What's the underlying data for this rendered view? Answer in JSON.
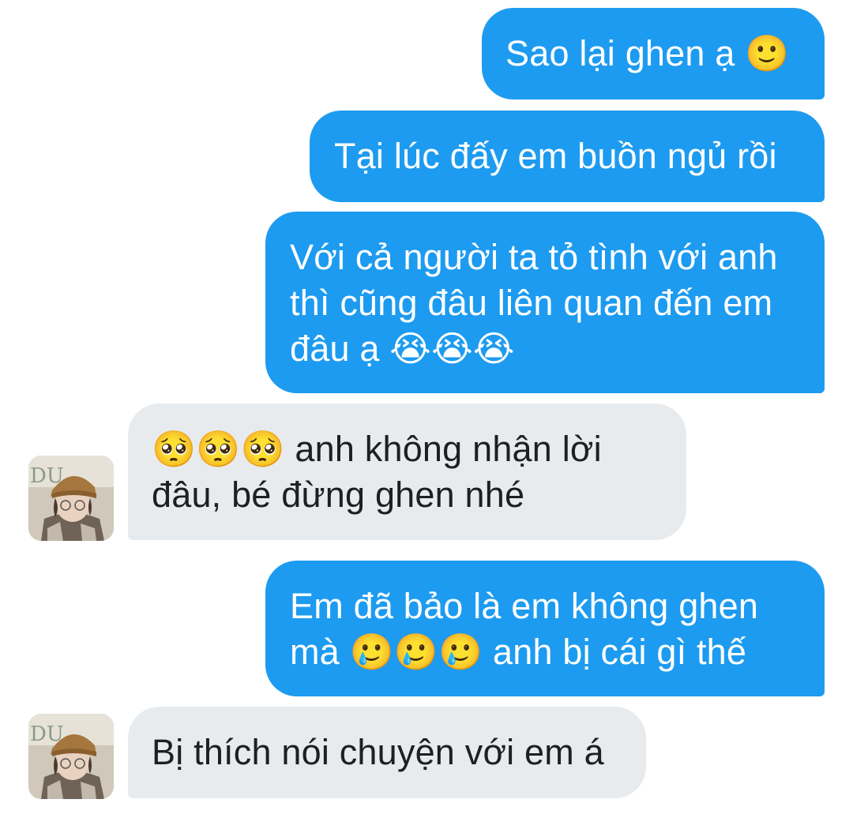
{
  "conversation": {
    "messages": [
      {
        "sender": "me",
        "lines": [
          "Sao lại ghen ạ 🙂"
        ]
      },
      {
        "sender": "me",
        "lines": [
          "Tại lúc đấy em buồn ngủ rồi"
        ]
      },
      {
        "sender": "me",
        "lines": [
          "Với cả người ta tỏ tình với anh",
          "thì cũng đâu liên quan đến em",
          "đâu ạ 😭😭😭"
        ]
      },
      {
        "sender": "them",
        "lines": [
          "🥺🥺🥺 anh không nhận lời",
          "đâu, bé đừng ghen nhé"
        ]
      },
      {
        "sender": "me",
        "lines": [
          "Em đã bảo là em không ghen",
          "mà 🥲🥲🥲 anh bị cái gì thế"
        ]
      },
      {
        "sender": "them",
        "lines": [
          "Bị thích nói chuyện với em á"
        ]
      }
    ]
  },
  "colors": {
    "sent_bubble": "#1d9bf0",
    "received_bubble": "#e7ebee",
    "sent_text": "#ffffff",
    "received_text": "#1f1f1f"
  },
  "icons": {
    "avatar": "user-avatar-photo"
  }
}
